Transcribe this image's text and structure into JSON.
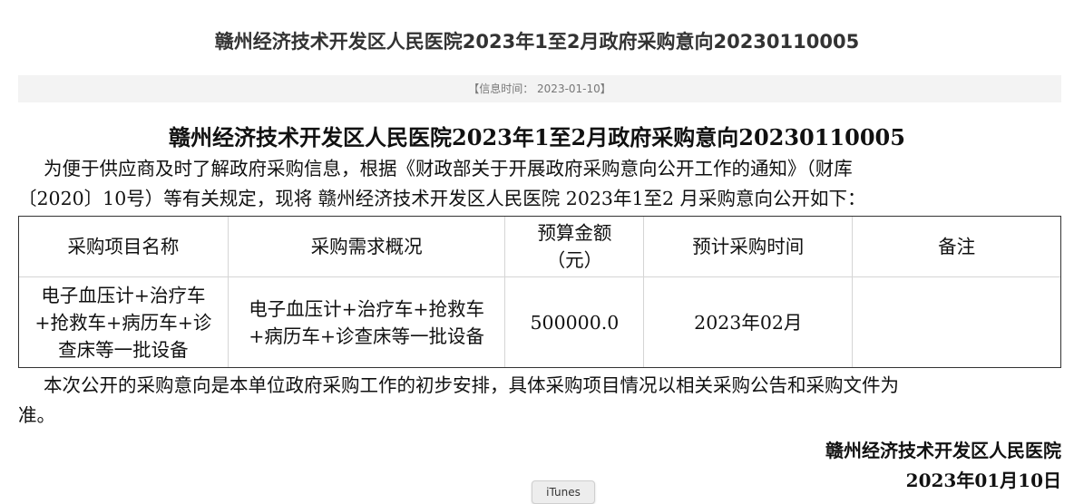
{
  "page_title": "赣州经济技术开发区人民医院2023年1至2月政府采购意向20230110005",
  "info_bar": "【信息时间： 2023-01-10】",
  "document": {
    "title": "赣州经济技术开发区人民医院2023年1至2月政府采购意向20230110005",
    "intro_line1": "为便于供应商及时了解政府采购信息，根据《财政部关于开展政府采购意向公开工作的通知》（财库",
    "intro_line2": "〔2020〕10号）等有关规定，现将 赣州经济技术开发区人民医院 2023年1至2 月采购意向公开如下：",
    "table": {
      "headers": {
        "name": "采购项目名称",
        "desc": "采购需求概况",
        "budget_line1": "预算金额",
        "budget_line2": "（元）",
        "time": "预计采购时间",
        "note": "备注"
      },
      "rows": [
        {
          "name_line1": "电子血压计+治疗车",
          "name_line2": "+抢救车+病历车+诊",
          "name_line3": "查床等一批设备",
          "desc_line1": "电子血压计+治疗车+抢救车",
          "desc_line2": "+病历车+诊查床等一批设备",
          "budget": "500000.0",
          "time": "2023年02月",
          "note": ""
        }
      ]
    },
    "closing_line1": "本次公开的采购意向是本单位政府采购工作的初步安排，具体采购项目情况以相关采购公告和采购文件为",
    "closing_line2": "准。",
    "signer": "赣州经济技术开发区人民医院",
    "sign_date": "2023年01月10日"
  },
  "floating_button": "iTunes"
}
